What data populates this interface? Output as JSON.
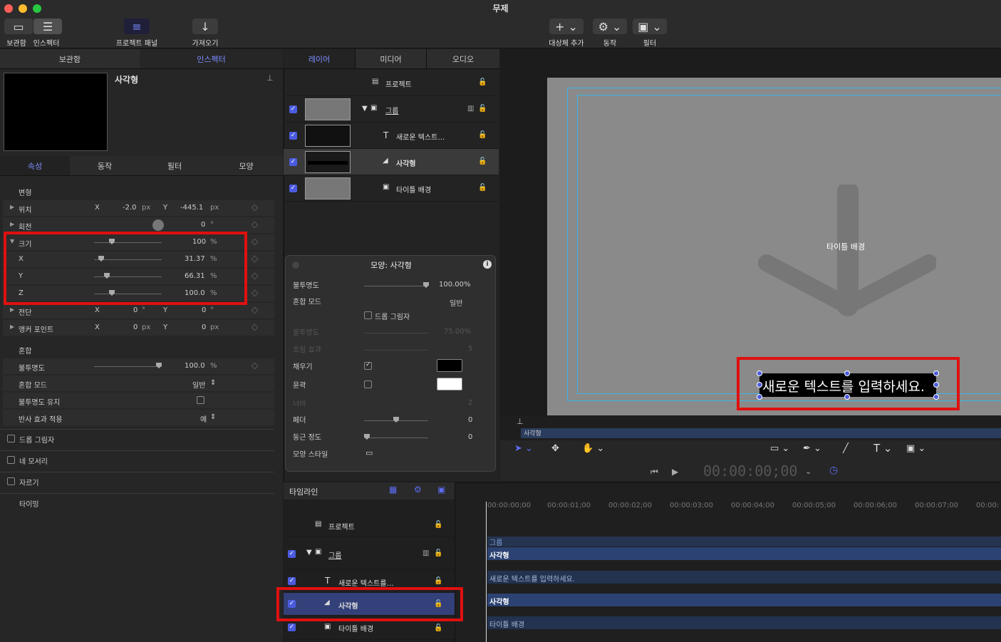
{
  "window": {
    "title": "무제"
  },
  "toolbar": {
    "library_label": "보관함",
    "inspector_label": "인스펙터",
    "project_panel_label": "프로젝트 패널",
    "import_label": "가져오기",
    "add_object_label": "대상체 추가",
    "behaviors_label": "동작",
    "filters_label": "필터"
  },
  "left": {
    "tabs": [
      "보관함",
      "인스펙터"
    ],
    "preview_title": "사각형",
    "subtabs": [
      "속성",
      "동작",
      "필터",
      "모양"
    ],
    "transform": {
      "header": "변형",
      "position": {
        "label": "위치",
        "x_label": "X",
        "x": "-2.0",
        "x_unit": "px",
        "y_label": "Y",
        "y": "-445.1",
        "y_unit": "px"
      },
      "rotation": {
        "label": "회전",
        "value": "0",
        "unit": "°"
      },
      "scale": {
        "label": "크기",
        "value": "100",
        "unit": "%",
        "x_label": "X",
        "x": "31.37",
        "y_label": "Y",
        "y": "66.31",
        "z_label": "Z",
        "z": "100.0"
      },
      "shear": {
        "label": "전단",
        "x_label": "X",
        "x": "0",
        "x_unit": "°",
        "y_label": "Y",
        "y": "0",
        "y_unit": "°"
      },
      "anchor": {
        "label": "앵커 포인트",
        "x_label": "X",
        "x": "0",
        "x_unit": "px",
        "y_label": "Y",
        "y": "0",
        "y_unit": "px"
      }
    },
    "blend": {
      "header": "혼합",
      "opacity_label": "불투명도",
      "opacity": "100.0",
      "opacity_unit": "%",
      "mode_label": "혼합 모드",
      "mode": "일반",
      "preserve_label": "불투명도 유지",
      "reflection_label": "반사 효과 적용",
      "reflection": "예"
    },
    "drop_shadow": "드롭 그림자",
    "four_corner": "네 모서리",
    "crop": "자르기",
    "timing": "타이밍"
  },
  "layers": {
    "tabs": [
      "레이어",
      "미디어",
      "오디오"
    ],
    "project": "프로젝트",
    "group": "그룹",
    "text": "새로운 텍스트…",
    "shape": "사각형",
    "title_bg": "타이틀 배경"
  },
  "hud": {
    "title": "모양: 사각형",
    "opacity_label": "불투명도",
    "opacity": "100.00%",
    "blend_label": "혼합 모드",
    "blend": "일반",
    "drop_shadow": "드롭 그림자",
    "shadow_opacity_label": "불투명도",
    "shadow_opacity": "75.00%",
    "blur_label": "흐림 효과",
    "blur": "5",
    "fill_label": "채우기",
    "outline_label": "윤곽",
    "width_label": "너비",
    "width": "2",
    "feather_label": "페더",
    "feather": "0",
    "roundness_label": "둥근 정도",
    "roundness": "0",
    "style_label": "모양 스타일"
  },
  "canvas": {
    "overlay_label": "타이틀 배경",
    "text": "새로운 텍스트를 입력하세요.",
    "mini_label": "사각형",
    "timecode": "00:00:00;00"
  },
  "timeline": {
    "label": "타임라인",
    "project": "프로젝트",
    "group": "그룹",
    "text": "새로운 텍스트를…",
    "shape": "사각형",
    "title_bg": "타이틀 배경",
    "ruler": [
      "00:00:00;00",
      "00:00:01;00",
      "00:00:02;00",
      "00:00:03;00",
      "00:00:04;00",
      "00:00:05;00",
      "00:00:06;00",
      "00:00:07;00",
      "00:00:"
    ],
    "bars": {
      "group": "그룹",
      "shape1": "사각형",
      "text": "새로운 텍스트를 입력하세요.",
      "shape2": "사각형",
      "title_bg": "타이틀 배경"
    }
  },
  "colors": {
    "accent": "#4b5be0",
    "highlight": "#e01010",
    "canvas": "#8a8a8a",
    "fill_swatch": "#000000",
    "outline_swatch": "#ffffff"
  }
}
